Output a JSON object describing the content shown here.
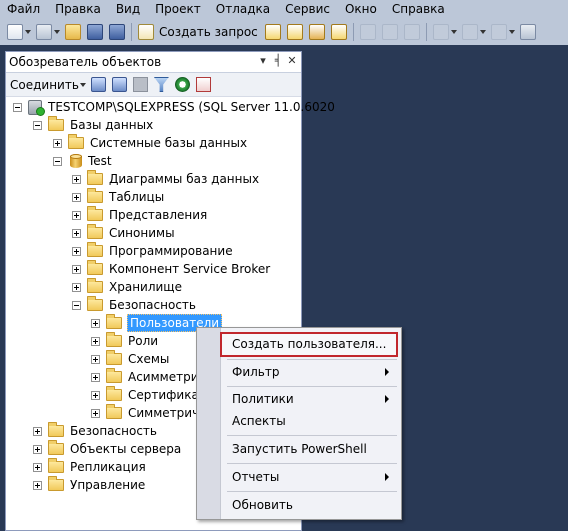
{
  "menubar": {
    "items": [
      "Файл",
      "Правка",
      "Вид",
      "Проект",
      "Отладка",
      "Сервис",
      "Окно",
      "Справка"
    ]
  },
  "toolbar": {
    "new_query_label": "Создать запрос"
  },
  "panel": {
    "title": "Обозреватель объектов",
    "pin_glyph": "▾",
    "pin2_glyph": "╡",
    "close_glyph": "✕",
    "connect_label": "Соединить"
  },
  "tree": {
    "server": "TESTCOMP\\SQLEXPRESS (SQL Server 11.0.6020",
    "databases": "Базы данных",
    "system_dbs": "Системные базы данных",
    "test_db": "Test",
    "diagrams": "Диаграммы баз данных",
    "tables": "Таблицы",
    "views": "Представления",
    "synonyms": "Синонимы",
    "programmability": "Программирование",
    "service_broker": "Компонент Service Broker",
    "storage": "Хранилище",
    "db_security": "Безопасность",
    "users": "Пользователи",
    "roles": "Роли",
    "schemas": "Схемы",
    "asym_keys": "Асимметрич",
    "certificates": "Сертификат",
    "sym_keys": "Симметрич",
    "security": "Безопасность",
    "server_objects": "Объекты сервера",
    "replication": "Репликация",
    "management": "Управление"
  },
  "context_menu": {
    "create_user": "Создать пользователя...",
    "filter": "Фильтр",
    "policies": "Политики",
    "facets": "Аспекты",
    "powershell": "Запустить PowerShell",
    "reports": "Отчеты",
    "refresh": "Обновить"
  },
  "colors": {
    "background": "#293955",
    "highlight_border": "#c1272d",
    "selection": "#3399ff"
  }
}
